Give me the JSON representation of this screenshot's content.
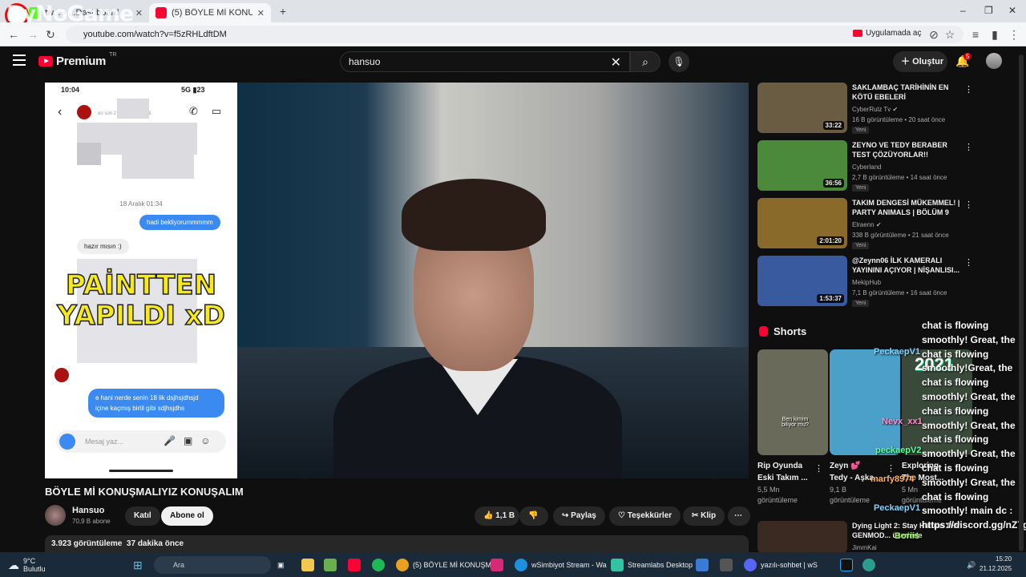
{
  "browser": {
    "tabs": [
      {
        "label": "tw... - ...Dashboard",
        "color": "#53fc18"
      },
      {
        "label": "(5) BÖYLE Mİ KONUŞMALIYIZ K",
        "color": "#ff0033"
      }
    ],
    "url": "youtube.com/watch?v=f5zRHLdftDM",
    "open_app": "Uygulamada aç"
  },
  "watermark": "ByNoGame",
  "youtube": {
    "logo": "Premium",
    "region": "TR",
    "search_query": "hansuo",
    "create_label": "Oluştur",
    "notif_count": "5"
  },
  "video": {
    "phone": {
      "time": "10:04",
      "signal": "5G",
      "battery": "23",
      "seen": "en son 2 saat önce aktifti",
      "date": "18 Aralık 01:34",
      "msg_out_1": "hadi bekliyorummmmm",
      "msg_in_1": "hazır mısın :)",
      "overlay_line1": "PAİNTTEN",
      "overlay_line2": "YAPILDI xD",
      "msg_out_2a": "e hani nerde senin 18 lik dsjhsjdhsjd",
      "msg_out_2b": "içine kaçmış birtil gibi sdjhsjdhs",
      "message_placeholder": "Mesaj yaz..."
    },
    "title": "BÖYLE Mİ KONUŞMALIYIZ KONUŞALIM",
    "channel": "Hansuo",
    "subs": "70,9 B abone",
    "join": "Katıl",
    "subscribe": "Abone ol",
    "likes": "1,1 B",
    "share": "Paylaş",
    "thanks": "Teşekkürler",
    "clip": "Klip",
    "views": "3.923 görüntüleme",
    "posted": "37 dakika önce"
  },
  "recommendations": [
    {
      "title": "SAKLAMBAÇ TARİHİNİN EN KÖTÜ EBELERİ",
      "channel": "CyberRulz Tv",
      "meta": "16 B görüntüleme • 20 saat önce",
      "duration": "33:22",
      "badge": "Yeni",
      "thumb": "#6a5c42"
    },
    {
      "title": "ZEYNO VE TEDY BERABER TEST ÇÖZÜYORLAR!!",
      "channel": "Cyberland",
      "meta": "2,7 B görüntüleme • 14 saat önce",
      "duration": "36:56",
      "badge": "Yeni",
      "thumb": "#4a8a3a"
    },
    {
      "title": "TAKIM DENGESİ MÜKEMMEL! | PARTY ANIMALS | BÖLÜM 9",
      "channel": "Elraenn",
      "meta": "338 B görüntüleme • 21 saat önce",
      "duration": "2:01:20",
      "badge": "Yeni",
      "thumb": "#8a6a2a"
    },
    {
      "title": "@Zeynn06 İLK KAMERALI YAYININI AÇIYOR | NİŞANLISI...",
      "channel": "MekipHub",
      "meta": "7,1 B görüntüleme • 16 saat önce",
      "duration": "1:53:37",
      "badge": "Yeni",
      "thumb": "#3a5aa0"
    }
  ],
  "shorts": {
    "heading": "Shorts",
    "items": [
      {
        "title_1": "Rip Oyunda",
        "title_2": "Eski Takım ...",
        "views_1": "5,5 Mn",
        "views_2": "görüntüleme",
        "thumb": "#6a6a5a"
      },
      {
        "title_1": "Zeyn 💕",
        "title_2": "Tedy - Aşka...",
        "views_1": "9,1 B",
        "views_2": "görüntüleme",
        "thumb": "#4aa0c8"
      },
      {
        "title_1": "Exploring",
        "title_2": "The Most...",
        "views_1": "5 Mn",
        "views_2": "görüntüleme",
        "thumb": "#3a4a3a"
      }
    ],
    "thumb_caption": "Ben kimim biliyor mu?",
    "thumb_year": "2021"
  },
  "next_video": {
    "title": "Dying Light 2: Stay Human THV GENMOD... üzerinde",
    "channel": "JimmKai"
  },
  "chat_overlay": {
    "text": "chat is flowing smoothly! Great, the chat is flowing smoothly!Great, the chat is flowing smoothly! Great, the chat is flowing smoothly! Great, the chat is flowing smoothly! Great, the chat is flowing smoothly! Great, the chat is flowing smoothly! main dc : https://discord.gg/nZ7grUHJpz",
    "names": [
      {
        "name": "PeckaepV1",
        "color": "#7fd4ff"
      },
      {
        "name": "Nevx_xx1",
        "color": "#ff8fd1"
      },
      {
        "name": "peckaepV2",
        "color": "#5fff9f"
      },
      {
        "name": "marfy8974",
        "color": "#ffb060"
      },
      {
        "name": "PeckaepV1",
        "color": "#7fd4ff"
      },
      {
        "name": "Boriis",
        "color": "#9fff5f"
      }
    ]
  },
  "taskbar": {
    "weather_temp": "9°C",
    "weather_desc": "Bulutlu",
    "search_placeholder": "Ara",
    "apps": [
      {
        "label": "(5) BÖYLE Mİ KONUŞMA",
        "color": "#e8a020"
      },
      {
        "label": "wSimbiyot Stream - Wa",
        "color": "#1f8fe0"
      },
      {
        "label": "Streamlabs Desktop",
        "color": "#31c3a2"
      },
      {
        "label": "yazılı-sohbet | wS",
        "color": "#5865f2"
      }
    ],
    "time": "15:20",
    "date": "21.12.2025"
  }
}
